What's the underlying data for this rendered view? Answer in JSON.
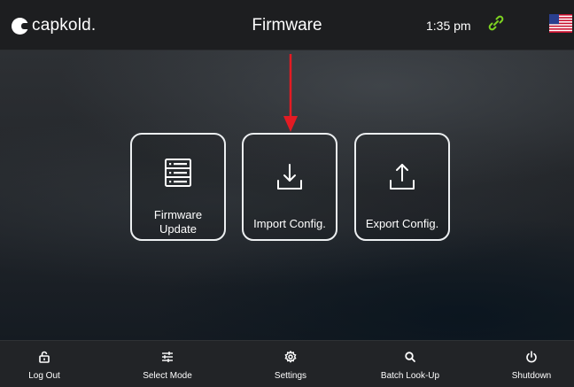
{
  "header": {
    "brand": "capkold.",
    "title": "Firmware",
    "time": "1:35 pm",
    "link_icon": "link-icon",
    "flag_icon": "us-flag-icon"
  },
  "tiles": [
    {
      "label": "Firmware\nUpdate",
      "icon": "server-list-icon"
    },
    {
      "label": "Import Config.",
      "icon": "download-icon"
    },
    {
      "label": "Export Config.",
      "icon": "upload-icon"
    }
  ],
  "annotation": {
    "icon": "red-arrow-down-icon",
    "color": "#e31b23"
  },
  "footer": {
    "items": [
      {
        "label": "Log Out",
        "icon": "lock-icon"
      },
      {
        "label": "Select Mode",
        "icon": "sliders-icon"
      },
      {
        "label": "Settings",
        "icon": "gear-icon"
      },
      {
        "label": "Batch Look-Up",
        "icon": "search-icon"
      },
      {
        "label": "Shutdown",
        "icon": "power-icon"
      }
    ]
  },
  "colors": {
    "link_green": "#7dd321",
    "accent_red": "#e31b23"
  }
}
